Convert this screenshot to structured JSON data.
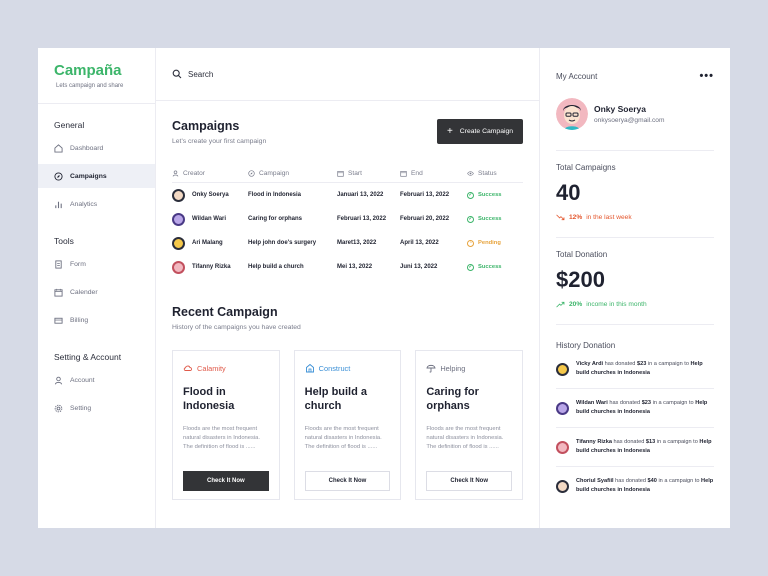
{
  "brand": {
    "name": "Campaña",
    "tagline": "Lets campaign and share"
  },
  "sidebar": {
    "sections": [
      {
        "title": "General",
        "items": [
          "Dashboard",
          "Campaigns",
          "Analytics"
        ]
      },
      {
        "title": "Tools",
        "items": [
          "Form",
          "Calender",
          "Billing"
        ]
      },
      {
        "title": "Setting & Account",
        "items": [
          "Account",
          "Setting"
        ]
      }
    ]
  },
  "search": {
    "label": "Search"
  },
  "campaigns": {
    "title": "Campaigns",
    "subtitle": "Let's create your first campaign",
    "create_label": "Create Campaign",
    "columns": [
      "Creator",
      "Campaign",
      "Start",
      "End",
      "Status"
    ],
    "rows": [
      {
        "creator": "Onky Soerya",
        "campaign": "Flood in Indonesia",
        "start": "Januari 13, 2022",
        "end": "Februari 13, 2022",
        "status": "Success"
      },
      {
        "creator": "Wildan Wari",
        "campaign": "Caring for orphans",
        "start": "Februari 13, 2022",
        "end": "Februari 20, 2022",
        "status": "Success"
      },
      {
        "creator": "Ari Malang",
        "campaign": "Help john doe's surgery",
        "start": "Maret13, 2022",
        "end": "April 13, 2022",
        "status": "Pending"
      },
      {
        "creator": "Tifanny Rizka",
        "campaign": "Help build a church",
        "start": "Mei 13, 2022",
        "end": "Juni 13, 2022",
        "status": "Success"
      }
    ]
  },
  "recent": {
    "title": "Recent Campaign",
    "subtitle": "History of the campaigns you have created",
    "cards": [
      {
        "tag": "Calamity",
        "title": "Flood in Indonesia",
        "desc": "Floods are the most frequent natural disasters in Indonesia. The definition of flood is ......",
        "button": "Check It Now"
      },
      {
        "tag": "Construct",
        "title": "Help build a church",
        "desc": "Floods are the most frequent natural disasters in Indonesia. The definition of flood is ......",
        "button": "Check It Now"
      },
      {
        "tag": "Helping",
        "title": "Caring for orphans",
        "desc": "Floods are the most frequent natural disasters in Indonesia. The definition of flood is ......",
        "button": "Check It Now"
      }
    ]
  },
  "account": {
    "title": "My Account",
    "more": "•••",
    "name": "Onky Soerya",
    "email": "onkysoerya@gmail.com",
    "total_campaigns": {
      "label": "Total Campaigns",
      "value": "40",
      "delta": "12%",
      "note": "in the last week"
    },
    "total_donation": {
      "label": "Total Donation",
      "value": "$200",
      "delta": "20%",
      "note": "income in this month"
    },
    "history_title": "History Donation",
    "history": [
      {
        "name": "Vicky Ardi",
        "mid": "has donated",
        "amount": "$23",
        "pre": "in a campaign to",
        "target": "Help build churches in Indonesia"
      },
      {
        "name": "Wildan Wari",
        "mid": "has donated",
        "amount": "$23",
        "pre": "in a campaign to",
        "target": "Help build churches in Indonesia"
      },
      {
        "name": "Tifanny Rizka",
        "mid": "has donated",
        "amount": "$13",
        "pre": "in a campaign to",
        "target": "Help build churches in Indonesia"
      },
      {
        "name": "Choriul Syafiil",
        "mid": "has donated",
        "amount": "$40",
        "pre": "in a campaign to",
        "target": "Help build churches in Indonesia"
      }
    ]
  },
  "colors": {
    "accent": "#3cb56a",
    "danger": "#e4572e",
    "pending": "#e7a33c",
    "dark": "#333437",
    "calamity": "#e05a4a",
    "construct": "#3a8fd6",
    "helping": "#6d7080"
  }
}
